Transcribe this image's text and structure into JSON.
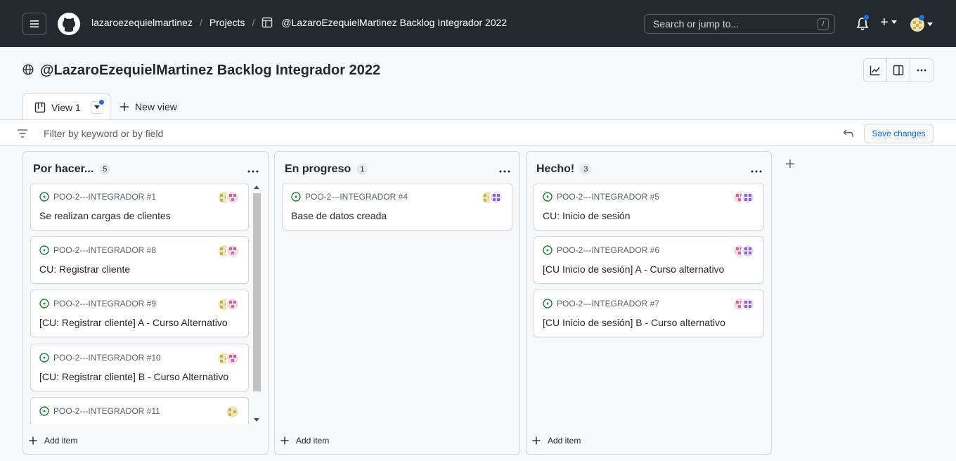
{
  "header": {
    "user": "lazaroezequielmartinez",
    "projects_label": "Projects",
    "project_crumb": "@LazaroEzequielMartinez Backlog Integrador 2022",
    "search_placeholder": "Search or jump to...",
    "search_shortcut": "/",
    "plus_label": "+"
  },
  "project": {
    "title": "@LazaroEzequielMartinez Backlog Integrador 2022"
  },
  "views": {
    "active_tab": "View 1",
    "new_view_label": "New view"
  },
  "filter": {
    "placeholder": "Filter by keyword or by field",
    "save_label": "Save changes"
  },
  "columns": [
    {
      "title": "Por hacer...",
      "count": "5",
      "add_label": "Add item",
      "cards": [
        {
          "ref": "POO-2---INTEGRADOR #1",
          "title": "Se realizan cargas de clientes"
        },
        {
          "ref": "POO-2---INTEGRADOR #8",
          "title": "CU: Registrar cliente"
        },
        {
          "ref": "POO-2---INTEGRADOR #9",
          "title": "[CU: Registrar cliente] A - Curso Alternativo"
        },
        {
          "ref": "POO-2---INTEGRADOR #10",
          "title": "[CU: Registrar cliente] B - Curso Alternativo"
        },
        {
          "ref": "POO-2---INTEGRADOR #11",
          "title": ""
        }
      ]
    },
    {
      "title": "En progreso",
      "count": "1",
      "add_label": "Add item",
      "cards": [
        {
          "ref": "POO-2---INTEGRADOR #4",
          "title": "Base de datos creada"
        }
      ]
    },
    {
      "title": "Hecho!",
      "count": "3",
      "add_label": "Add item",
      "cards": [
        {
          "ref": "POO-2---INTEGRADOR #5",
          "title": "CU: Inicio de sesión"
        },
        {
          "ref": "POO-2---INTEGRADOR #6",
          "title": "[CU Inicio de sesión] A - Curso alternativo"
        },
        {
          "ref": "POO-2---INTEGRADOR #7",
          "title": "[CU Inicio de sesión] B - Curso alternativo"
        }
      ]
    }
  ],
  "colors": {
    "header_bg": "#24292f",
    "accent": "#0969da",
    "open_issue": "#1a7f37",
    "notification": "#1f6feb"
  }
}
